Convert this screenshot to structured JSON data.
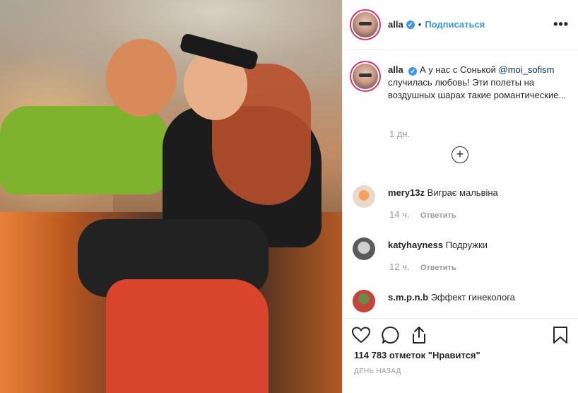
{
  "post": {
    "username": "alla",
    "verified_mark": "✔",
    "separator": "•",
    "follow_label": "Подписаться",
    "more_label": "•••",
    "caption": {
      "username": "alla",
      "text_before": "А у нас с Сонькой",
      "mention": "@moi_sofism",
      "text_after": "случилась любовь! Эти полеты на воздушных шарах такие романтические...",
      "time": "1 дн."
    },
    "load_more_label": "+"
  },
  "comments": [
    {
      "username": "mery13z",
      "text": "Виграє мальвіна",
      "time": "14 ч.",
      "reply_label": "Ответить"
    },
    {
      "username": "katyhayness",
      "text": "Подружки",
      "time": "12 ч.",
      "reply_label": "Ответить"
    },
    {
      "username": "s.m.p.n.b",
      "text": "Эффект гинеколога"
    }
  ],
  "footer": {
    "likes": "114 783 отметок \"Нравится\"",
    "date": "ДЕНЬ НАЗАД"
  },
  "icons": [
    "heart-icon",
    "comment-icon",
    "share-icon",
    "bookmark-icon",
    "verified-icon",
    "more-icon",
    "plus-circle-icon"
  ],
  "colors": {
    "link": "#3897f0",
    "mention": "#003569",
    "muted": "#999999",
    "story_ring": "#e1306c"
  }
}
